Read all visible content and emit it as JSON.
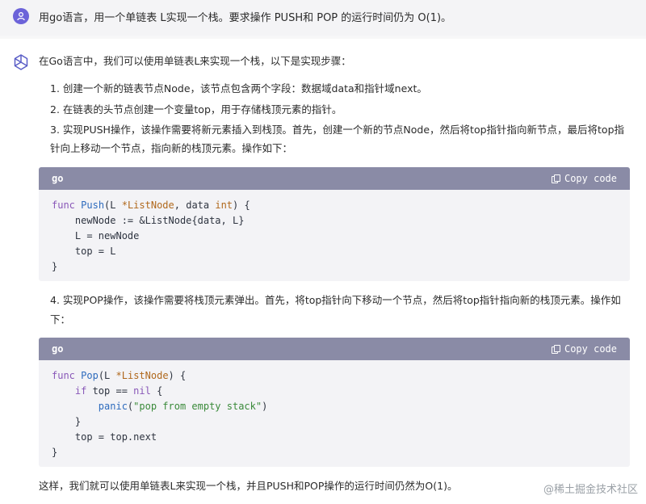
{
  "user": {
    "avatar_icon": "user-icon",
    "prompt": "用go语言，用一个单链表 L实现一个栈。要求操作 PUSH和 POP 的运行时间仍为 O(1)。"
  },
  "answer": {
    "bot_icon": "assistant-logo-icon",
    "intro": "在Go语言中，我们可以使用单链表L来实现一个栈，以下是实现步骤：",
    "step1": "1. 创建一个新的链表节点Node，该节点包含两个字段：数据域data和指针域next。",
    "step2": "2. 在链表的头节点创建一个变量top，用于存储栈顶元素的指针。",
    "step3_line1": "3. 实现PUSH操作，该操作需要将新元素插入到栈顶。首先，创建一个新的节点Node，然后将top指针指向新节点，最后将top指",
    "step3_line2": "针向上移动一个节点，指向新的栈顶元素。操作如下：",
    "step4_line1": "4. 实现POP操作，该操作需要将栈顶元素弹出。首先，将top指针向下移动一个节点，然后将top指针指向新的栈顶元素。操作如",
    "step4_line2": "下：",
    "conclusion": "这样，我们就可以使用单链表L来实现一个栈，并且PUSH和POP操作的运行时间仍然为O(1)。"
  },
  "code_blocks": [
    {
      "lang": "go",
      "copy_label": "Copy code",
      "lines": [
        "func Push(L *ListNode, data int) {",
        "    newNode := &ListNode{data, L}",
        "    L = newNode",
        "    top = L",
        "}"
      ]
    },
    {
      "lang": "go",
      "copy_label": "Copy code",
      "lines": [
        "func Pop(L *ListNode) {",
        "    if top == nil {",
        "        panic(\"pop from empty stack\")",
        "    }",
        "    top = top.next",
        "}"
      ]
    }
  ],
  "watermark": "@稀土掘金技术社区",
  "colors": {
    "avatar": "#6c63d9",
    "code_header": "#8a8ba6",
    "code_bg": "#f3f3f6",
    "page_bg": "#f7f7f8"
  }
}
